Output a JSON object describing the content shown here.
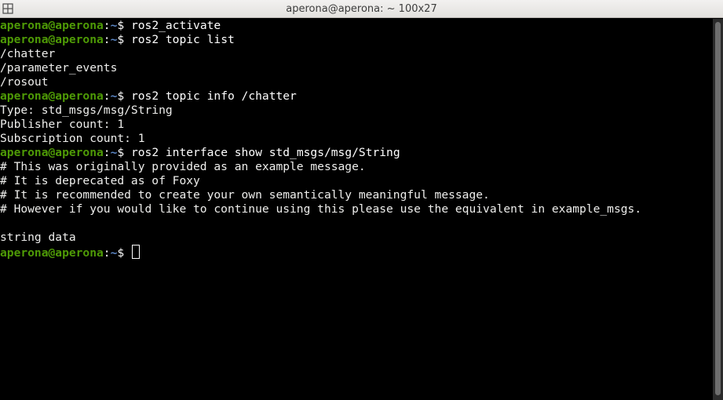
{
  "window": {
    "title": "aperona@aperona: ~ 100x27",
    "menu_icon": "window-menu-icon"
  },
  "prompt": {
    "user_host": "aperona@aperona",
    "colon": ":",
    "path": "~",
    "symbol": "$ "
  },
  "lines": {
    "l1_cmd": "ros2_activate",
    "l2_cmd": "ros2 topic list",
    "l3": "/chatter",
    "l4": "/parameter_events",
    "l5": "/rosout",
    "l6_cmd": "ros2 topic info /chatter",
    "l7": "Type: std_msgs/msg/String",
    "l8": "Publisher count: 1",
    "l9": "Subscription count: 1",
    "l10_cmd": "ros2 interface show std_msgs/msg/String",
    "l11": "# This was originally provided as an example message.",
    "l12": "# It is deprecated as of Foxy",
    "l13": "# It is recommended to create your own semantically meaningful message.",
    "l14": "# However if you would like to continue using this please use the equivalent in example_msgs.",
    "l15": "",
    "l16": "string data"
  },
  "colors": {
    "prompt_user": "#4e9a06",
    "prompt_path": "#5c87c6",
    "background": "#000000",
    "text": "#ffffff"
  }
}
